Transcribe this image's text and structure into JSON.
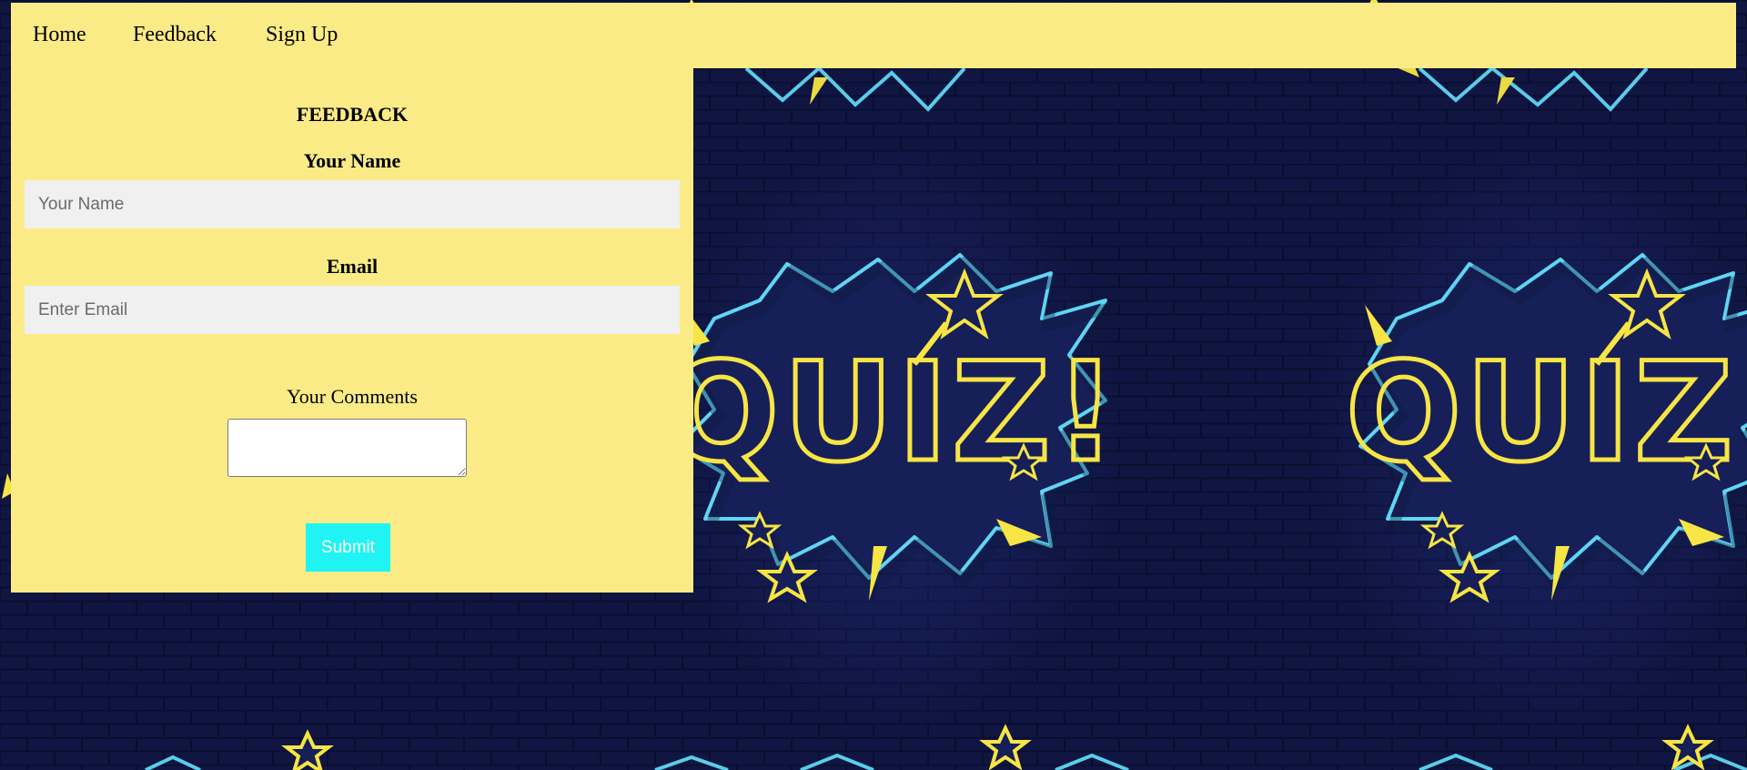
{
  "nav": {
    "items": [
      {
        "label": "Home"
      },
      {
        "label": "Feedback"
      },
      {
        "label": "Sign Up"
      }
    ]
  },
  "form": {
    "title": "FEEDBACK",
    "name_label": "Your Name",
    "name_placeholder": "Your Name",
    "name_value": "",
    "email_label": "Email",
    "email_placeholder": "Enter Email",
    "email_value": "",
    "comments_label": "Your Comments",
    "comments_value": "",
    "submit_label": "Submit"
  },
  "background": {
    "banner_text": "QUIZ!",
    "colors": {
      "wall": "#121846",
      "brick_line": "#0b1033",
      "neon_yellow": "#f6e545",
      "neon_cyan": "#5fd6f2",
      "panel": "#fbeb86",
      "submit": "#1ff3f3"
    }
  }
}
